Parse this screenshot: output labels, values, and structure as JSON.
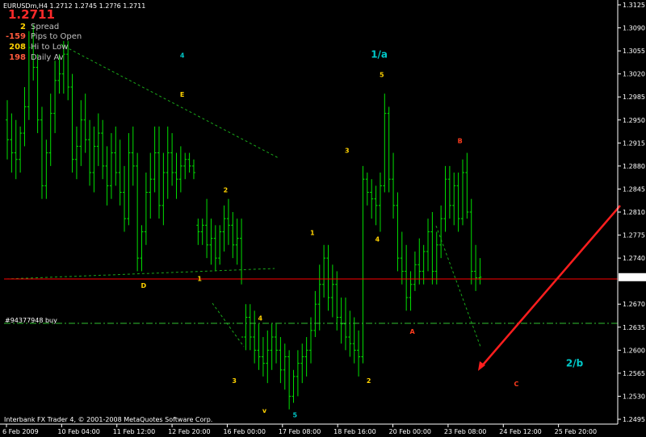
{
  "header": {
    "symbol_line": "EURUSDm,H4  1.2712 1.2745 1.27?6 1.2711"
  },
  "current_price_big": "1.2711",
  "info_panel": [
    {
      "value": "2",
      "label": "Spread",
      "color": "#ffd200"
    },
    {
      "value": "-159",
      "label": "Pips to Open",
      "color": "#ff5a3c"
    },
    {
      "value": "208",
      "label": "Hi to Low",
      "color": "#ffd200"
    },
    {
      "value": "198",
      "label": "Daily Av",
      "color": "#ff5a3c"
    }
  ],
  "order_label": "#94377948 buy",
  "footer": "Interbank FX Trader 4, © 2001-2008 MetaQuotes Software Corp.",
  "chart_data": {
    "type": "ohlc",
    "ylim": [
      1.2495,
      1.3125
    ],
    "y_ticks": [
      "1.3125",
      "1.3090",
      "1.3055",
      "1.3020",
      "1.2985",
      "1.2950",
      "1.2915",
      "1.2880",
      "1.2845",
      "1.2810",
      "1.2775",
      "1.2740",
      "1.2711",
      "1.2670",
      "1.2635",
      "1.2600",
      "1.2565",
      "1.2530",
      "1.2495"
    ],
    "current_price": 1.2711,
    "x_ticks": [
      "6 Feb 2009",
      "10 Feb 04:00",
      "11 Feb 12:00",
      "12 Feb 20:00",
      "16 Feb 00:00",
      "17 Feb 08:00",
      "18 Feb 16:00",
      "20 Feb 00:00",
      "23 Feb 08:00",
      "24 Feb 12:00",
      "25 Feb 20:00"
    ],
    "colors": {
      "bars": "#00e000",
      "price_line": "#ff0000",
      "order_line": "#2fbf2f",
      "trend": "#1aa81a",
      "arrow": "#ff1e1e"
    },
    "wave_labels": [
      {
        "text": "4",
        "color": "#00c8c8",
        "price": 1.3045,
        "bar": 40
      },
      {
        "text": "E",
        "color": "#ffd200",
        "price": 1.2985,
        "bar": 40
      },
      {
        "text": "2",
        "color": "#ffd200",
        "price": 1.284,
        "bar": 50
      },
      {
        "text": "D",
        "color": "#ffd200",
        "price": 1.2695,
        "bar": 31
      },
      {
        "text": "1",
        "color": "#ffd200",
        "price": 1.2705,
        "bar": 44
      },
      {
        "text": "4",
        "color": "#ffd200",
        "price": 1.2645,
        "bar": 58
      },
      {
        "text": "3",
        "color": "#ffd200",
        "price": 1.255,
        "bar": 52
      },
      {
        "text": "v",
        "color": "#ffd200",
        "price": 1.2505,
        "bar": 59
      },
      {
        "text": "5",
        "color": "#00c8c8",
        "price": 1.2498,
        "bar": 66
      },
      {
        "text": "1",
        "color": "#ffd200",
        "price": 1.2775,
        "bar": 70
      },
      {
        "text": "3",
        "color": "#ffd200",
        "price": 1.29,
        "bar": 78
      },
      {
        "text": "2",
        "color": "#ffd200",
        "price": 1.255,
        "bar": 83
      },
      {
        "text": "4",
        "color": "#ffd200",
        "price": 1.2765,
        "bar": 85
      },
      {
        "text": "5",
        "color": "#ffd200",
        "price": 1.3015,
        "bar": 86
      },
      {
        "text": "1/a",
        "color": "#00c8c8",
        "price": 1.3045,
        "bar": 84,
        "big": true
      },
      {
        "text": "A",
        "color": "#ff3c1e",
        "price": 1.2625,
        "bar": 93
      },
      {
        "text": "B",
        "color": "#ff3c1e",
        "price": 1.2915,
        "bar": 104
      },
      {
        "text": "C",
        "color": "#ff3c1e",
        "price": 1.2545,
        "bar": 117
      },
      {
        "text": "2/b",
        "color": "#00c8c8",
        "price": 1.2575,
        "bar": 129,
        "big": true
      }
    ],
    "ohlc": [
      [
        1.295,
        1.298,
        1.289,
        1.292
      ],
      [
        1.292,
        1.296,
        1.287,
        1.29
      ],
      [
        1.29,
        1.295,
        1.286,
        1.289
      ],
      [
        1.289,
        1.294,
        1.287,
        1.293
      ],
      [
        1.293,
        1.3,
        1.291,
        1.297
      ],
      [
        1.297,
        1.3085,
        1.295,
        1.306
      ],
      [
        1.306,
        1.3095,
        1.301,
        1.303
      ],
      [
        1.303,
        1.305,
        1.293,
        1.295
      ],
      [
        1.295,
        1.297,
        1.283,
        1.285
      ],
      [
        1.285,
        1.292,
        1.283,
        1.29
      ],
      [
        1.29,
        1.299,
        1.288,
        1.296
      ],
      [
        1.296,
        1.304,
        1.293,
        1.301
      ],
      [
        1.301,
        1.305,
        1.299,
        1.302
      ],
      [
        1.302,
        1.307,
        1.299,
        1.305
      ],
      [
        1.305,
        1.307,
        1.298,
        1.3
      ],
      [
        1.3,
        1.302,
        1.287,
        1.289
      ],
      [
        1.289,
        1.294,
        1.286,
        1.291
      ],
      [
        1.291,
        1.298,
        1.288,
        1.295
      ],
      [
        1.295,
        1.299,
        1.29,
        1.292
      ],
      [
        1.292,
        1.295,
        1.285,
        1.287
      ],
      [
        1.287,
        1.294,
        1.284,
        1.291
      ],
      [
        1.291,
        1.296,
        1.288,
        1.293
      ],
      [
        1.293,
        1.295,
        1.286,
        1.288
      ],
      [
        1.288,
        1.291,
        1.282,
        1.285
      ],
      [
        1.285,
        1.293,
        1.283,
        1.29
      ],
      [
        1.29,
        1.294,
        1.285,
        1.287
      ],
      [
        1.287,
        1.292,
        1.282,
        1.284
      ],
      [
        1.284,
        1.288,
        1.278,
        1.28
      ],
      [
        1.28,
        1.293,
        1.279,
        1.29
      ],
      [
        1.29,
        1.294,
        1.285,
        1.288
      ],
      [
        1.288,
        1.29,
        1.272,
        1.274
      ],
      [
        1.274,
        1.279,
        1.272,
        1.278
      ],
      [
        1.278,
        1.287,
        1.276,
        1.284
      ],
      [
        1.284,
        1.29,
        1.28,
        1.286
      ],
      [
        1.286,
        1.294,
        1.284,
        1.29
      ],
      [
        1.29,
        1.294,
        1.28,
        1.282
      ],
      [
        1.282,
        1.29,
        1.279,
        1.287
      ],
      [
        1.287,
        1.294,
        1.283,
        1.29
      ],
      [
        1.29,
        1.293,
        1.285,
        1.287
      ],
      [
        1.287,
        1.29,
        1.283,
        1.286
      ],
      [
        1.286,
        1.291,
        1.284,
        1.288
      ],
      [
        1.288,
        1.29,
        1.286,
        1.289
      ],
      [
        1.289,
        1.29,
        1.287,
        1.288
      ],
      [
        1.288,
        1.289,
        1.286,
        1.287
      ],
      [
        1.279,
        1.28,
        1.276,
        1.278
      ],
      [
        1.278,
        1.28,
        1.276,
        1.279
      ],
      [
        1.279,
        1.283,
        1.274,
        1.276
      ],
      [
        1.276,
        1.28,
        1.273,
        1.277
      ],
      [
        1.277,
        1.279,
        1.272,
        1.274
      ],
      [
        1.274,
        1.279,
        1.273,
        1.278
      ],
      [
        1.278,
        1.282,
        1.275,
        1.28
      ],
      [
        1.28,
        1.283,
        1.276,
        1.279
      ],
      [
        1.279,
        1.281,
        1.274,
        1.276
      ],
      [
        1.276,
        1.28,
        1.273,
        1.277
      ],
      [
        1.277,
        1.28,
        1.27,
        1.262
      ],
      [
        1.262,
        1.267,
        1.26,
        1.265
      ],
      [
        1.265,
        1.267,
        1.26,
        1.262
      ],
      [
        1.262,
        1.266,
        1.258,
        1.26
      ],
      [
        1.26,
        1.264,
        1.257,
        1.259
      ],
      [
        1.259,
        1.262,
        1.256,
        1.258
      ],
      [
        1.258,
        1.263,
        1.255,
        1.26
      ],
      [
        1.26,
        1.264,
        1.257,
        1.262
      ],
      [
        1.262,
        1.264,
        1.258,
        1.26
      ],
      [
        1.26,
        1.262,
        1.255,
        1.257
      ],
      [
        1.257,
        1.261,
        1.254,
        1.259
      ],
      [
        1.259,
        1.26,
        1.251,
        1.253
      ],
      [
        1.253,
        1.257,
        1.252,
        1.256
      ],
      [
        1.256,
        1.26,
        1.253,
        1.258
      ],
      [
        1.258,
        1.261,
        1.255,
        1.259
      ],
      [
        1.259,
        1.262,
        1.256,
        1.26
      ],
      [
        1.26,
        1.265,
        1.258,
        1.263
      ],
      [
        1.263,
        1.269,
        1.262,
        1.267
      ],
      [
        1.267,
        1.273,
        1.263,
        1.27
      ],
      [
        1.27,
        1.276,
        1.268,
        1.274
      ],
      [
        1.274,
        1.276,
        1.266,
        1.268
      ],
      [
        1.268,
        1.273,
        1.265,
        1.27
      ],
      [
        1.27,
        1.272,
        1.263,
        1.265
      ],
      [
        1.265,
        1.268,
        1.261,
        1.264
      ],
      [
        1.264,
        1.268,
        1.26,
        1.262
      ],
      [
        1.262,
        1.266,
        1.259,
        1.261
      ],
      [
        1.261,
        1.265,
        1.258,
        1.26
      ],
      [
        1.26,
        1.263,
        1.256,
        1.259
      ],
      [
        1.259,
        1.288,
        1.258,
        1.286
      ],
      [
        1.286,
        1.287,
        1.282,
        1.284
      ],
      [
        1.284,
        1.286,
        1.28,
        1.283
      ],
      [
        1.283,
        1.285,
        1.279,
        1.282
      ],
      [
        1.282,
        1.287,
        1.278,
        1.285
      ],
      [
        1.285,
        1.299,
        1.284,
        1.296
      ],
      [
        1.296,
        1.297,
        1.284,
        1.286
      ],
      [
        1.286,
        1.29,
        1.28,
        1.282
      ],
      [
        1.282,
        1.284,
        1.272,
        1.274
      ],
      [
        1.274,
        1.278,
        1.27,
        1.272
      ],
      [
        1.272,
        1.276,
        1.266,
        1.268
      ],
      [
        1.268,
        1.272,
        1.266,
        1.27
      ],
      [
        1.27,
        1.275,
        1.269,
        1.273
      ],
      [
        1.273,
        1.277,
        1.27,
        1.272
      ],
      [
        1.272,
        1.276,
        1.27,
        1.275
      ],
      [
        1.275,
        1.28,
        1.272,
        1.278
      ],
      [
        1.278,
        1.281,
        1.27,
        1.272
      ],
      [
        1.272,
        1.278,
        1.27,
        1.276
      ],
      [
        1.276,
        1.282,
        1.274,
        1.28
      ],
      [
        1.28,
        1.288,
        1.278,
        1.286
      ],
      [
        1.286,
        1.288,
        1.28,
        1.282
      ],
      [
        1.282,
        1.287,
        1.279,
        1.285
      ],
      [
        1.285,
        1.287,
        1.278,
        1.28
      ],
      [
        1.28,
        1.289,
        1.279,
        1.287
      ],
      [
        1.287,
        1.29,
        1.28,
        1.281
      ],
      [
        1.281,
        1.283,
        1.27,
        1.272
      ],
      [
        1.272,
        1.276,
        1.269,
        1.271
      ],
      [
        1.271,
        1.274,
        1.27,
        1.2711
      ]
    ]
  }
}
